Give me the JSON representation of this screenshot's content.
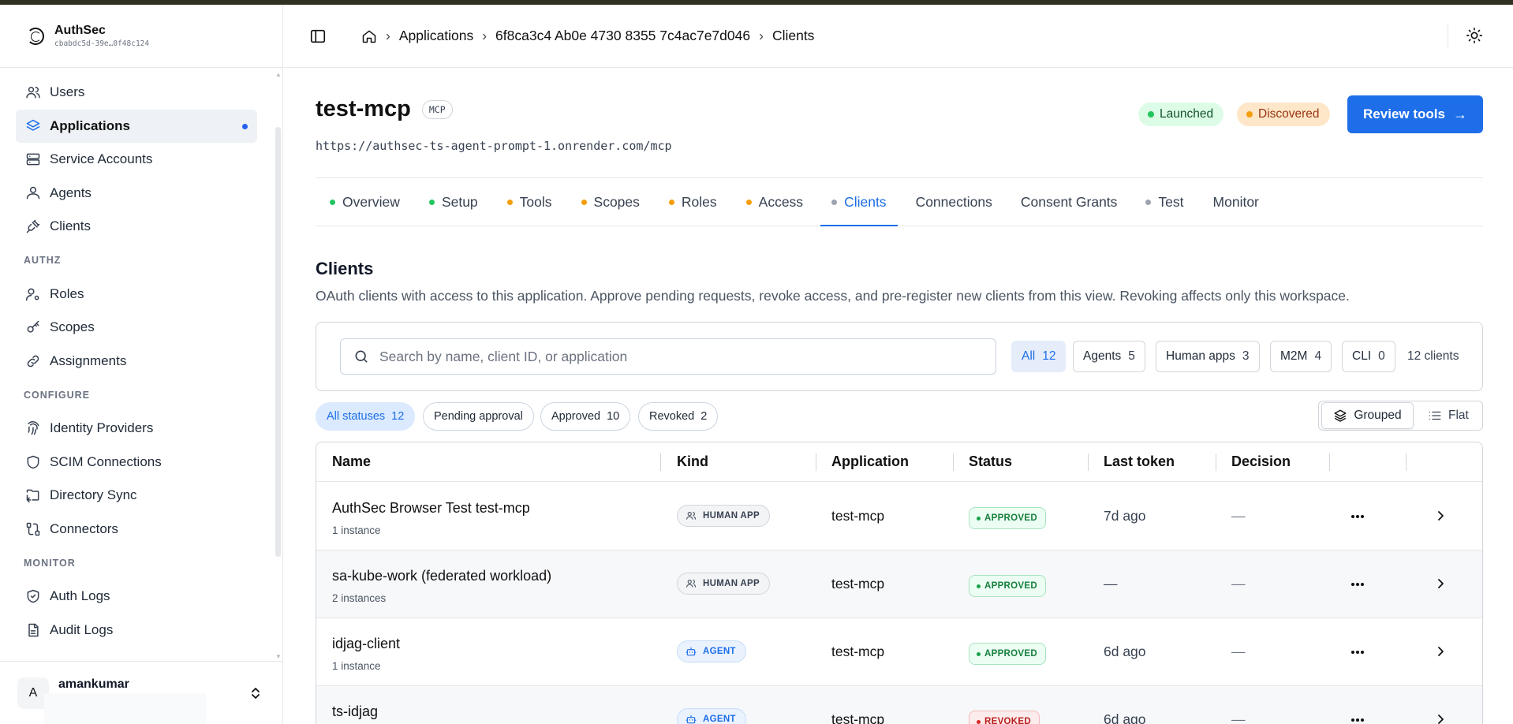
{
  "brand": {
    "name": "AuthSec",
    "workspace_id": "cbabdc5d-39e…0f48c124"
  },
  "sidebar": {
    "groups": [
      {
        "label": "",
        "items": [
          {
            "label": "Users",
            "icon": "users-icon"
          },
          {
            "label": "Applications",
            "icon": "layers-icon",
            "active": true
          },
          {
            "label": "Service Accounts",
            "icon": "server-icon"
          },
          {
            "label": "Agents",
            "icon": "bot-icon"
          },
          {
            "label": "Clients",
            "icon": "plug-icon"
          }
        ]
      },
      {
        "label": "AUTHZ",
        "items": [
          {
            "label": "Roles",
            "icon": "user-cog-icon"
          },
          {
            "label": "Scopes",
            "icon": "key-icon"
          },
          {
            "label": "Assignments",
            "icon": "link-icon"
          }
        ]
      },
      {
        "label": "CONFIGURE",
        "items": [
          {
            "label": "Identity Providers",
            "icon": "fingerprint-icon"
          },
          {
            "label": "SCIM Connections",
            "icon": "shield-icon"
          },
          {
            "label": "Directory Sync",
            "icon": "folder-sync-icon"
          },
          {
            "label": "Connectors",
            "icon": "cable-icon"
          }
        ]
      },
      {
        "label": "MONITOR",
        "items": [
          {
            "label": "Auth Logs",
            "icon": "shield-check-icon"
          },
          {
            "label": "Audit Logs",
            "icon": "file-text-icon"
          }
        ]
      }
    ],
    "user": {
      "initial": "A",
      "name": "amankumar"
    }
  },
  "breadcrumbs": [
    "Applications",
    "6f8ca3c4 Ab0e 4730 8355 7c4ac7e7d046",
    "Clients"
  ],
  "app": {
    "title": "test-mcp",
    "type_badge": "MCP",
    "url": "https://authsec-ts-agent-prompt-1.onrender.com/mcp",
    "pills": [
      {
        "label": "Launched",
        "color": "#22c55e"
      },
      {
        "label": "Discovered",
        "color": "#f59e0b"
      }
    ],
    "review_button": "Review tools"
  },
  "tabs": [
    {
      "label": "Overview",
      "dot": "#22c55e"
    },
    {
      "label": "Setup",
      "dot": "#22c55e"
    },
    {
      "label": "Tools",
      "dot": "#f59e0b"
    },
    {
      "label": "Scopes",
      "dot": "#f59e0b"
    },
    {
      "label": "Roles",
      "dot": "#f59e0b"
    },
    {
      "label": "Access",
      "dot": "#f59e0b"
    },
    {
      "label": "Clients",
      "dot": "#9ca3af",
      "active": true
    },
    {
      "label": "Connections",
      "dot": ""
    },
    {
      "label": "Consent Grants",
      "dot": ""
    },
    {
      "label": "Test",
      "dot": "#9ca3af"
    },
    {
      "label": "Monitor",
      "dot": ""
    }
  ],
  "section": {
    "title": "Clients",
    "description": "OAuth clients with access to this application. Approve pending requests, revoke access, and pre-register new clients from this view. Revoking affects only this workspace."
  },
  "filters": {
    "search_placeholder": "Search by name, client ID, or application",
    "kinds": [
      {
        "label": "All",
        "count": "12",
        "active": true
      },
      {
        "label": "Agents",
        "count": "5"
      },
      {
        "label": "Human apps",
        "count": "3"
      },
      {
        "label": "M2M",
        "count": "4"
      },
      {
        "label": "CLI",
        "count": "0"
      }
    ],
    "total_text": "12 clients",
    "statuses": [
      {
        "label": "All statuses",
        "count": "12",
        "active": true
      },
      {
        "label": "Pending approval",
        "count": ""
      },
      {
        "label": "Approved",
        "count": "10"
      },
      {
        "label": "Revoked",
        "count": "2"
      }
    ],
    "view": {
      "grouped": "Grouped",
      "flat": "Flat"
    }
  },
  "table": {
    "columns": [
      "Name",
      "Kind",
      "Application",
      "Status",
      "Last token",
      "Decision"
    ],
    "rows": [
      {
        "name": "AuthSec Browser Test test-mcp",
        "sub": "1 instance",
        "kind": "HUMAN APP",
        "kind_type": "human",
        "app": "test-mcp",
        "status": "APPROVED",
        "status_type": "approved",
        "last_token": "7d ago",
        "decision": "—"
      },
      {
        "name": "sa-kube-work (federated workload)",
        "sub": "2 instances",
        "kind": "HUMAN APP",
        "kind_type": "human",
        "app": "test-mcp",
        "status": "APPROVED",
        "status_type": "approved",
        "last_token": "—",
        "decision": "—"
      },
      {
        "name": "idjag-client",
        "sub": "1 instance",
        "kind": "AGENT",
        "kind_type": "agent",
        "app": "test-mcp",
        "status": "APPROVED",
        "status_type": "approved",
        "last_token": "6d ago",
        "decision": "—"
      },
      {
        "name": "ts-idjag",
        "sub": "",
        "kind": "AGENT",
        "kind_type": "agent",
        "app": "test-mcp",
        "status": "REVOKED",
        "status_type": "revoked",
        "last_token": "6d ago",
        "decision": "—"
      }
    ]
  }
}
